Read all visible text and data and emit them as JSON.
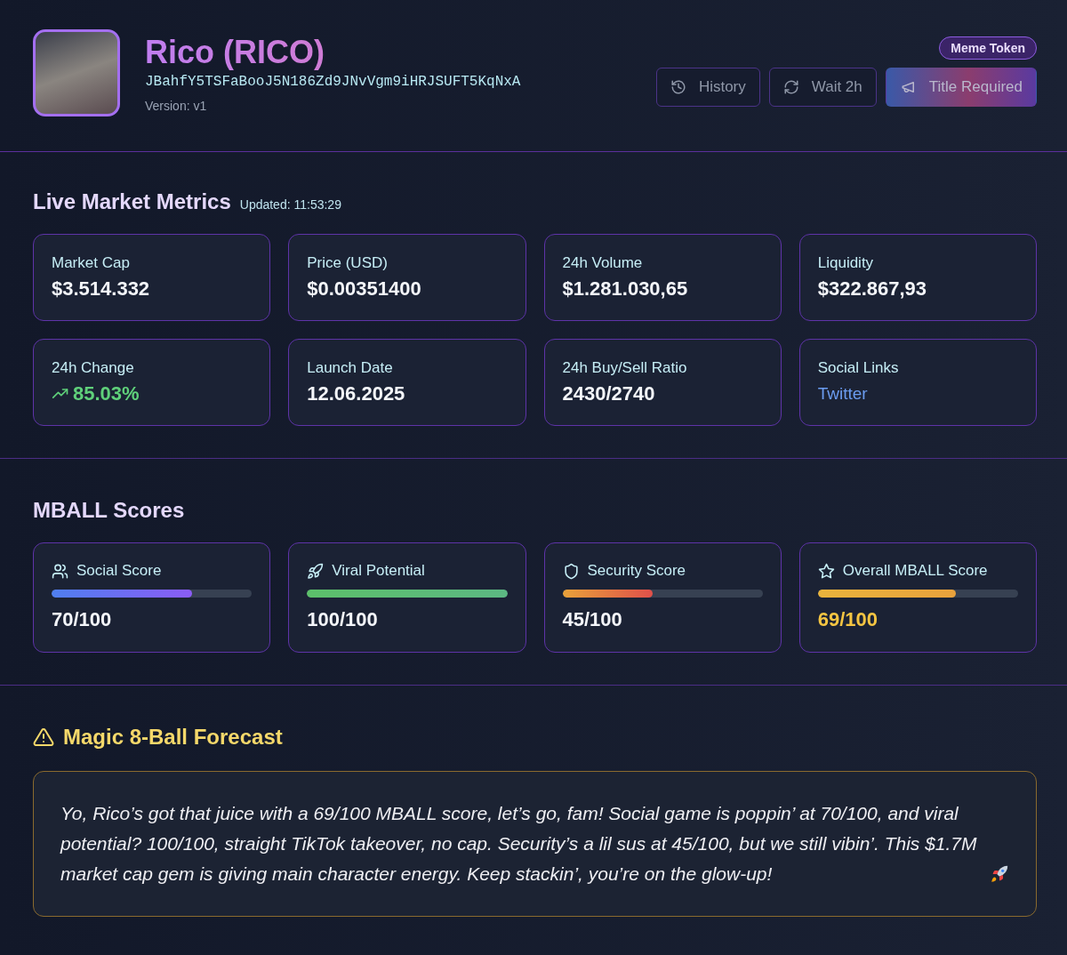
{
  "token": {
    "name": "Rico (RICO)",
    "address": "JBahfY5TSFaBooJ5N186Zd9JNvVgm9iHRJSUFT5KqNxA",
    "version": "Version: v1",
    "badge": "Meme Token"
  },
  "actions": [
    {
      "label": "History",
      "kind": "history"
    },
    {
      "label": "Wait 2h",
      "kind": "refresh"
    },
    {
      "label": "Title Required",
      "kind": "promote"
    }
  ],
  "metrics": {
    "title": "Live Market Metrics",
    "updated": "Updated: 11:53:29",
    "cards": [
      {
        "label": "Market Cap",
        "value": "$3.514.332",
        "kind": "plain"
      },
      {
        "label": "Price (USD)",
        "value": "$0.00351400",
        "kind": "plain"
      },
      {
        "label": "24h Volume",
        "value": "$1.281.030,65",
        "kind": "plain"
      },
      {
        "label": "Liquidity",
        "value": "$322.867,93",
        "kind": "plain"
      },
      {
        "label": "24h Change",
        "value": "85.03%",
        "kind": "change"
      },
      {
        "label": "Launch Date",
        "value": "12.06.2025",
        "kind": "plain"
      },
      {
        "label": "24h Buy/Sell Ratio",
        "value": "2430/2740",
        "kind": "plain"
      },
      {
        "label": "Social Links",
        "value": "Twitter",
        "kind": "link"
      }
    ]
  },
  "scores": {
    "title": "MBALL Scores",
    "items": [
      {
        "label": "Social Score",
        "value": "70/100",
        "level": 0.7,
        "kind": "social"
      },
      {
        "label": "Viral Potential",
        "value": "100/100",
        "level": 1.0,
        "kind": "viral"
      },
      {
        "label": "Security Score",
        "value": "45/100",
        "level": 0.45,
        "kind": "security"
      },
      {
        "label": "Overall MBALL Score",
        "value": "69/100",
        "level": 0.69,
        "kind": "overall"
      }
    ]
  },
  "forecast": {
    "title": "Magic 8-Ball Forecast",
    "text": "Yo, Rico’s got that juice with a 69/100 MBALL score, let’s go, fam! Social game is poppin’ at 70/100, and viral potential? 100/100, straight TikTok takeover, no cap. Security’s a lil sus at 45/100, but we still vibin’. This $1.7M market cap gem is giving main character energy. Keep stackin’, you’re on the glow-up!"
  }
}
